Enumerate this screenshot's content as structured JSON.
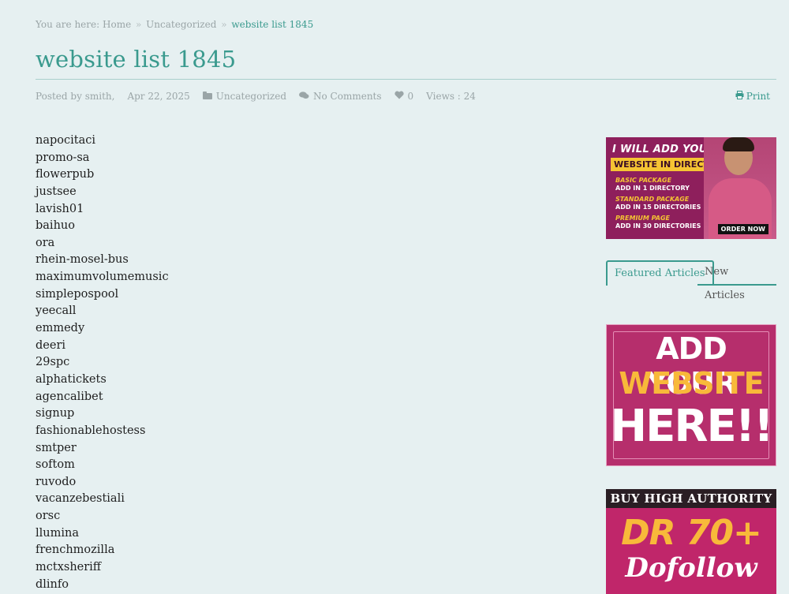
{
  "breadcrumb": {
    "prefix": "You are here:",
    "home": "Home",
    "sep": "»",
    "category": "Uncategorized",
    "current": "website list 1845"
  },
  "post": {
    "title": "website list 1845",
    "posted_by_label": "Posted by",
    "author": "smith,",
    "date": "Apr 22, 2025",
    "category": "Uncategorized",
    "comments": "No Comments",
    "likes": "0",
    "views": "Views : 24",
    "print": "Print"
  },
  "items": [
    "napocitaci",
    "promo-sa",
    "flowerpub",
    "justsee",
    "lavish01",
    "baihuo",
    "ora",
    "rhein-mosel-bus",
    "maximumvolumemusic",
    "simplepospool",
    "yeecall",
    "emmedy",
    "deeri",
    "29spc",
    "alphatickets",
    "agencalibet",
    "signup",
    "fashionablehostess",
    "smtper",
    "softom",
    "ruvodo",
    "vacanzebestiali",
    "orsc",
    "llumina",
    "frenchmozilla",
    "mctxsheriff",
    "dlinfo"
  ],
  "sidebar": {
    "ad1": {
      "headline": "I WILL ADD YOUR",
      "sub": "WEBSITE IN DIRECTORY",
      "packages": [
        {
          "name": "BASIC PACKAGE",
          "desc": "ADD IN 1 DIRECTORY"
        },
        {
          "name": "STANDARD PACKAGE",
          "desc": "ADD IN 15 DIRECTORIES"
        },
        {
          "name": "PREMIUM PAGE",
          "desc": "ADD IN 30 DIRECTORIES"
        }
      ],
      "cta": "ORDER NOW"
    },
    "tabs": {
      "featured": "Featured Articles",
      "new": "New Articles"
    },
    "ad2": {
      "line1": "ADD YOUR",
      "line2": "WEBSITE",
      "line3": "HERE!!"
    },
    "ad3": {
      "top": "BUY HIGH AUTHORITY",
      "big": "DR 70+",
      "script": "Dofollow"
    }
  },
  "colors": {
    "accent": "#3a9a8e",
    "background": "#e6f0f1"
  }
}
